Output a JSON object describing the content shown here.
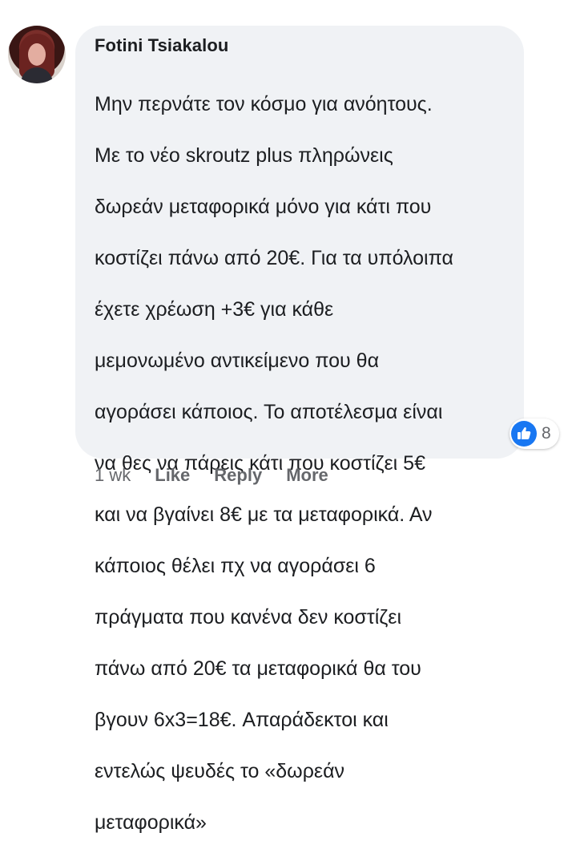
{
  "comment": {
    "author": "Fotini Tsiakalou",
    "text_lines": [
      "Μην περνάτε τον κόσμο για ανόητους.",
      "Με το νέο skroutz plus πληρώνεις",
      "δωρεάν μεταφορικά μόνο για κάτι που",
      "κοστίζει πάνω από 20€. Για τα υπόλοιπα",
      "έχετε χρέωση +3€ για κάθε",
      "μεμονωμένο αντικείμενο που θα",
      "αγοράσει κάποιος. Το αποτέλεσμα είναι",
      "να θες να πάρεις κάτι που κοστίζει 5€",
      "και να βγαίνει 8€ με τα μεταφορικά. Αν",
      "κάποιος θέλει πχ να αγοράσει 6",
      "πράγματα που κανένα δεν κοστίζει",
      "πάνω από 20€ τα μεταφορικά θα του",
      "βγουν 6x3=18€. Απαράδεκτοι και",
      "εντελώς ψευδές το «δωρεάν",
      "μεταφορικά»"
    ],
    "reaction_count": "8",
    "reaction_icon": "like-thumb-icon",
    "timestamp": "1 wk",
    "actions": {
      "like": "Like",
      "reply": "Reply",
      "more": "More"
    }
  },
  "colors": {
    "bubble_bg": "#f0f2f5",
    "like_blue": "#1877f2",
    "meta_gray": "#65676b",
    "text": "#1c1e21"
  }
}
